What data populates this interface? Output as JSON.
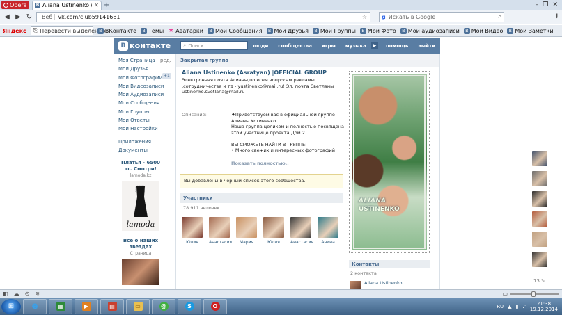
{
  "browser": {
    "menu_label": "Opera",
    "tab_title": "Aliana Ustinenko (Asrat...",
    "tab_favicon": "В",
    "url_badge": "Веб",
    "url": "vk.com/club59141681",
    "search_placeholder": "Искать в Google",
    "yandex_label": "Яндекс",
    "translate_label": "Перевести выделенно",
    "bookmarks": [
      {
        "label": "ВКонтакте"
      },
      {
        "label": "Темы"
      },
      {
        "label": "Аватарки"
      },
      {
        "label": "Мои Сообщения"
      },
      {
        "label": "Мои Друзья"
      },
      {
        "label": "Мои Группы"
      },
      {
        "label": "Мои Фото"
      },
      {
        "label": "Мои аудиозаписи"
      },
      {
        "label": "Мои Видео"
      },
      {
        "label": "Мои Заметки"
      }
    ]
  },
  "vk": {
    "logo_text": "контакте",
    "logo_mark": "В",
    "search_placeholder": "Поиск",
    "nav": [
      "люди",
      "сообщества",
      "игры",
      "музыка",
      "помощь",
      "выйти"
    ],
    "menu": [
      {
        "label": "Моя Страница"
      },
      {
        "label": "Мои Друзья"
      },
      {
        "label": "Мои Фотографии"
      },
      {
        "label": "Мои Видеозаписи"
      },
      {
        "label": "Мои Аудиозаписи"
      },
      {
        "label": "Мои Сообщения"
      },
      {
        "label": "Мои Группы"
      },
      {
        "label": "Мои Ответы"
      },
      {
        "label": "Мои Настройки"
      }
    ],
    "menu_edit": "ред.",
    "menu_badge": "+1",
    "menu_extra": [
      {
        "label": "Приложения"
      },
      {
        "label": "Документы"
      }
    ],
    "ad1": {
      "title": "Платья - 6500 тг. Смотри!",
      "source": "lamoda.kz",
      "logo": "lamoda"
    },
    "ad2": {
      "title": "Все о наших звездах",
      "source": "Страница"
    }
  },
  "group": {
    "closed_label": "Закрытая группа",
    "title": "Aliana Ustinenko (Asratyan) |OFFICIAL GROUP",
    "status": "Электронная почта Алианы,по всем вопросам рекламы ,сотрудничества и тд - yustinenko@mail.ru! Эл. почта Светланы ustinenko.svetlana@mail.ru",
    "desc_label": "Описание:",
    "desc_lines": [
      "♦Приветствуем вас в официальной группе Алианы Устиненко.",
      "Наша группа целиком и полностью посвящена этой участнице проекта Дом 2.",
      "",
      "ВЫ СМОЖЕТЕ НАЙТИ В ГРУППЕ:",
      "• Много свежих и интересных фотографий"
    ],
    "show_full": "Показать полностью..",
    "blacklist_notice": "Вы добавлены в чёрный список этого сообщества.",
    "members_header": "Участники",
    "members_count": "78 911 человек",
    "members": [
      {
        "name": "Юлия",
        "color": "#7a3a2e"
      },
      {
        "name": "Анастасия",
        "color": "#a46a50"
      },
      {
        "name": "Мария",
        "color": "#c89060"
      },
      {
        "name": "Юлия",
        "color": "#8a5a40"
      },
      {
        "name": "Анастасия",
        "color": "#3a3a3a"
      },
      {
        "name": "Анина",
        "color": "#2c7a8a"
      }
    ],
    "cover_text_1": "ALIANA",
    "cover_text_2": "USTINENKO",
    "contacts_header": "Контакты",
    "contacts_count": "2 контакта",
    "contact_name": "Aliana Ustinenko"
  },
  "sidebar_right": {
    "avatar_colors": [
      "#40506a",
      "#6a6a6a",
      "#2a2a2a",
      "#b45a3a",
      "#c0a080",
      "#303030"
    ],
    "count": "13"
  },
  "statusbar": {},
  "taskbar": {
    "lang": "RU",
    "time": "21:38",
    "date": "19.12.2014"
  },
  "colors": {
    "vk_header": "#597da3",
    "vk_link": "#2b587a",
    "opera_red": "#c8242b"
  }
}
